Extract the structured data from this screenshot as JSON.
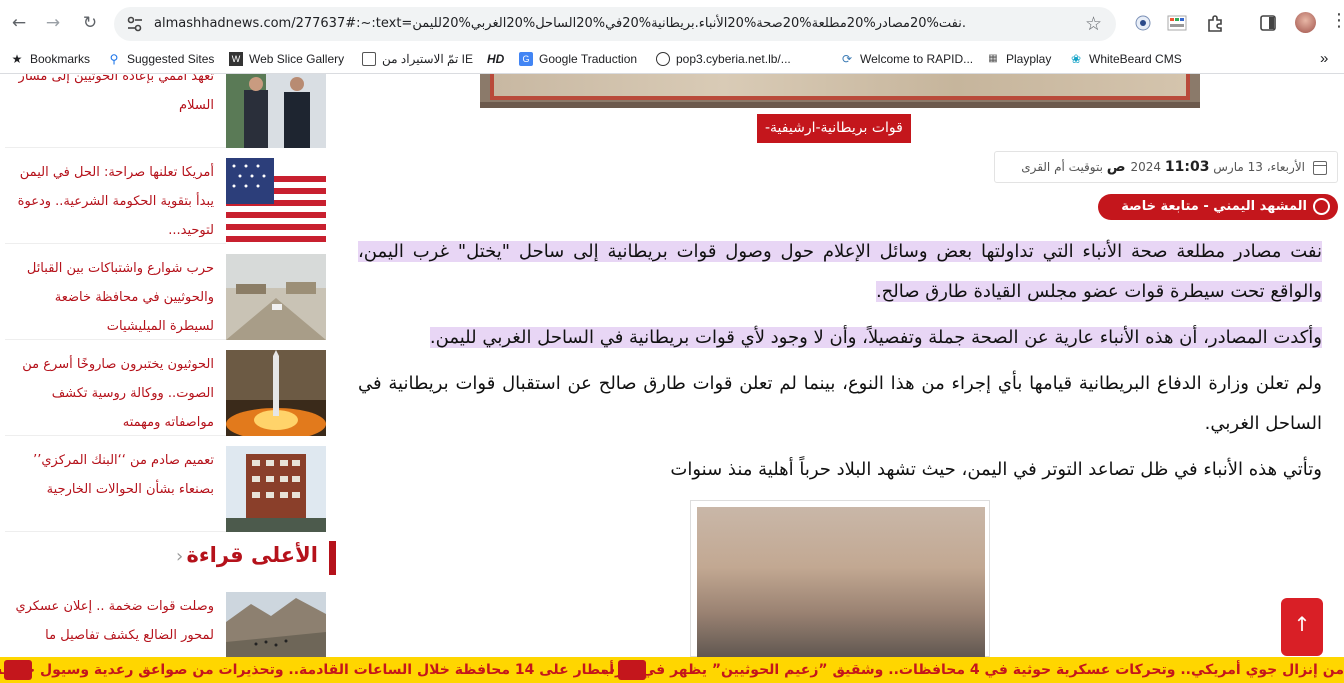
{
  "browser": {
    "url": "almashhadnews.com/277637#:~:text=نفت%20مصادر%20مطلعة%20صحة%20الأنباء.بريطانية%20في%20الساحل%20الغربي%20لليمن.",
    "bookmarks": [
      {
        "label": "Bookmarks",
        "icon": "star-icon"
      },
      {
        "label": "Suggested Sites",
        "icon": "search-icon"
      },
      {
        "label": "Web Slice Gallery",
        "icon": "slice-icon"
      },
      {
        "label": "تمّ الاستيراد من IE",
        "icon": "folder-icon"
      },
      {
        "label": "HD",
        "icon": "hd-icon"
      },
      {
        "label": "Google Traduction",
        "icon": "translate-icon"
      },
      {
        "label": "pop3.cyberia.net.lb/...",
        "icon": "globe-icon"
      },
      {
        "label": "Welcome to RAPID...",
        "icon": "rapid-icon"
      },
      {
        "label": "Playplay",
        "icon": "playplay-icon"
      },
      {
        "label": "WhiteBeard CMS",
        "icon": "whitebeard-icon"
      }
    ]
  },
  "sidebar": {
    "cards": [
      {
        "title": "تعهد أممي بإعادة الحوثيين إلى مسار السلام"
      },
      {
        "title": "أمريكا تعلنها صراحة: الحل في اليمن يبدأ بتقوية الحكومة الشرعية.. ودعوة لتوحيد..."
      },
      {
        "title": "حرب شوارع واشتباكات بين القبائل والحوثيين في محافظة خاضعة لسيطرة الميليشيات"
      },
      {
        "title": "الحوثيون يختبرون صاروخًا أسرع من الصوت.. ووكالة روسية تكشف مواصفاته ومهمته"
      },
      {
        "title": "تعميم صادم من ‘‘البنك المركزي’’ بصنعاء بشأن الحوالات الخارجية"
      }
    ],
    "section_title": "الأعلى قراءة",
    "top_read": [
      {
        "title": "وصلت قوات ضخمة .. إعلان عسكري لمحور الضالع يكشف تفاصيل ما"
      }
    ]
  },
  "article": {
    "caption": "قوات بريطانية-ارشيفية-",
    "date": "الأربعاء، 13 مارس 2024",
    "time": "11:03 ص",
    "tz": "بتوقيت أم القرى",
    "author": "المشهد اليمني - متابعة خاصة",
    "p1": "نفت مصادر مطلعة صحة الأنباء التي تداولتها بعض وسائل الإعلام حول وصول قوات بريطانية إلى ساحل \"يختل\" غرب اليمن، والواقع تحت سيطرة قوات عضو مجلس القيادة طارق صالح.",
    "p2": "وأكدت المصادر، أن هذه الأنباء عارية عن الصحة جملة وتفصيلاً، وأن لا وجود لأي قوات بريطانية في الساحل الغربي لليمن.",
    "p3": "ولم تعلن وزارة الدفاع البريطانية قيامها بأي إجراء من هذا النوع، بينما لم تعلن قوات طارق صالح عن استقبال قوات بريطانية في الساحل الغربي.",
    "p4": "وتأتي هذه الأنباء في ظل تصاعد التوتر في اليمن، حيث تشهد البلاد حرباً أهلية منذ سنوات"
  },
  "ticker": {
    "items": [
      "من إنزال جوي أمريكي.. وتحركات عسكرية حوثية في 4 محافظات.. وشقيق ”زعيم الحوثيين” يظهر في مارب",
      "أمطار على 14 محافظة خلال الساعات القادمة.. وتحذيرات من صواعق رعدية وسيول جارفة"
    ]
  },
  "colors": {
    "brand_red": "#c4161c",
    "ticker_yellow": "#ffd600",
    "highlight": "#e8d6f5"
  }
}
